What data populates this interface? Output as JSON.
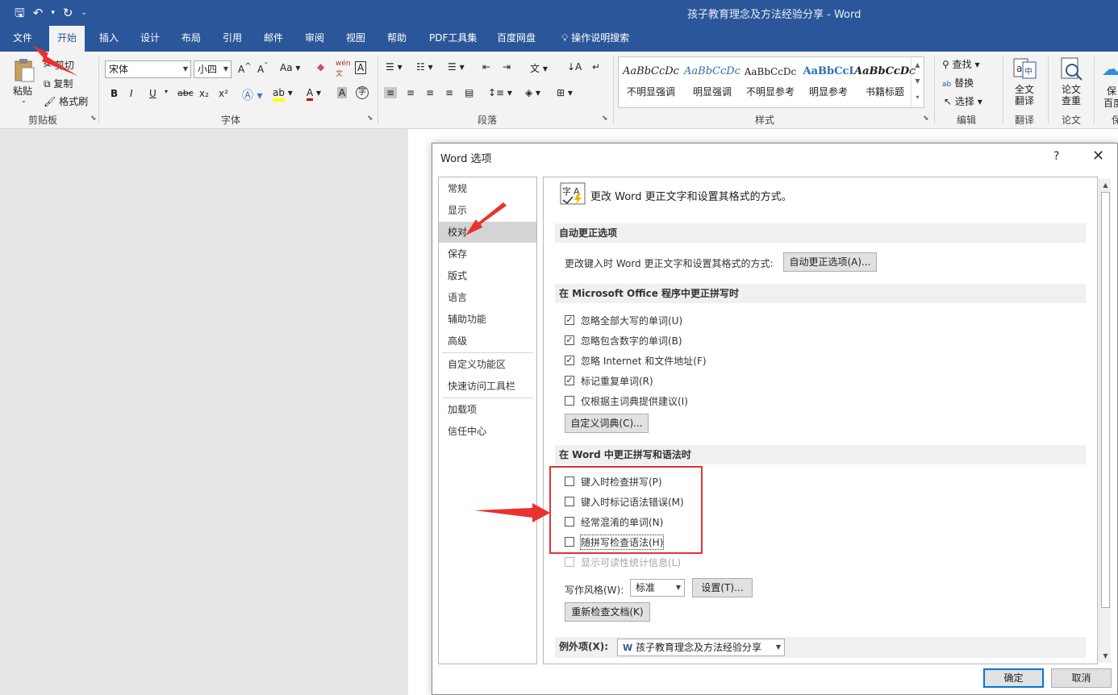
{
  "window": {
    "title": "孩子教育理念及方法经验分享 - Word"
  },
  "qat": {
    "save": "🖫",
    "undo": "↶",
    "redo": "↻",
    "more": "⌄"
  },
  "ribbon_tabs": [
    "文件",
    "开始",
    "插入",
    "设计",
    "布局",
    "引用",
    "邮件",
    "审阅",
    "视图",
    "帮助",
    "PDF工具集",
    "百度网盘",
    "操作说明搜索"
  ],
  "ribbon": {
    "clipboard": {
      "paste": "粘贴",
      "cut": "剪切",
      "copy": "复制",
      "format_painter": "格式刷",
      "label": "剪贴板"
    },
    "font": {
      "name": "宋体",
      "size": "小四",
      "label": "字体",
      "buttons": [
        "B",
        "I",
        "U",
        "abc",
        "x₂",
        "x²",
        "A",
        "A"
      ]
    },
    "paragraph": {
      "label": "段落"
    },
    "styles": {
      "label": "样式",
      "items": [
        {
          "preview": "AaBbCcDc",
          "name": "不明显强调"
        },
        {
          "preview": "AaBbCcDc",
          "name": "明显强调"
        },
        {
          "preview": "AaBbCcDc",
          "name": "不明显参考"
        },
        {
          "preview": "AaBbCcI",
          "name": "明显参考"
        },
        {
          "preview": "AaBbCcDc",
          "name": "书籍标题"
        }
      ]
    },
    "editing": {
      "find": "查找",
      "replace": "替换",
      "select": "选择",
      "label": "编辑"
    },
    "translate": {
      "btn": "全文\n翻译",
      "label": "翻译"
    },
    "paper": {
      "btn": "论文\n查重",
      "label": "论文"
    },
    "save_baidu": {
      "btn1": "保",
      "btn2": "百度",
      "label": "保"
    }
  },
  "dialog": {
    "title": "Word 选项",
    "help": "?",
    "close": "✕",
    "nav": [
      "常规",
      "显示",
      "校对",
      "保存",
      "版式",
      "语言",
      "辅助功能",
      "高级",
      "自定义功能区",
      "快速访问工具栏",
      "加载项",
      "信任中心"
    ],
    "selected_nav": "校对",
    "intro": "更改 Word 更正文字和设置其格式的方式。",
    "autocorrect": {
      "heading": "自动更正选项",
      "desc": "更改键入时 Word 更正文字和设置其格式的方式:",
      "button": "自动更正选项(A)..."
    },
    "office_spelling": {
      "heading": "在 Microsoft Office 程序中更正拼写时",
      "options": [
        {
          "label": "忽略全部大写的单词(U)",
          "checked": true
        },
        {
          "label": "忽略包含数字的单词(B)",
          "checked": true
        },
        {
          "label": "忽略 Internet 和文件地址(F)",
          "checked": true
        },
        {
          "label": "标记重复单词(R)",
          "checked": true
        },
        {
          "label": "仅根据主词典提供建议(I)",
          "checked": false
        }
      ],
      "custom_dict_button": "自定义词典(C)..."
    },
    "word_spelling": {
      "heading": "在 Word 中更正拼写和语法时",
      "options": [
        {
          "label": "键入时检查拼写(P)",
          "checked": false
        },
        {
          "label": "键入时标记语法错误(M)",
          "checked": false
        },
        {
          "label": "经常混淆的单词(N)",
          "checked": false
        },
        {
          "label": "随拼写检查语法(H)",
          "checked": false
        },
        {
          "label": "显示可读性统计信息(L)",
          "checked": false,
          "disabled": true
        }
      ],
      "writing_style_label": "写作风格(W):",
      "writing_style_value": "标准",
      "settings_button": "设置(T)...",
      "recheck_button": "重新检查文档(K)"
    },
    "exceptions": {
      "label": "例外项(X):",
      "doc": "孩子教育理念及方法经验分享"
    },
    "ok": "确定",
    "cancel": "取消"
  },
  "colors": {
    "brand": "#2b579a",
    "annotation": "#e8322f",
    "primary_focus": "#0078d7"
  }
}
